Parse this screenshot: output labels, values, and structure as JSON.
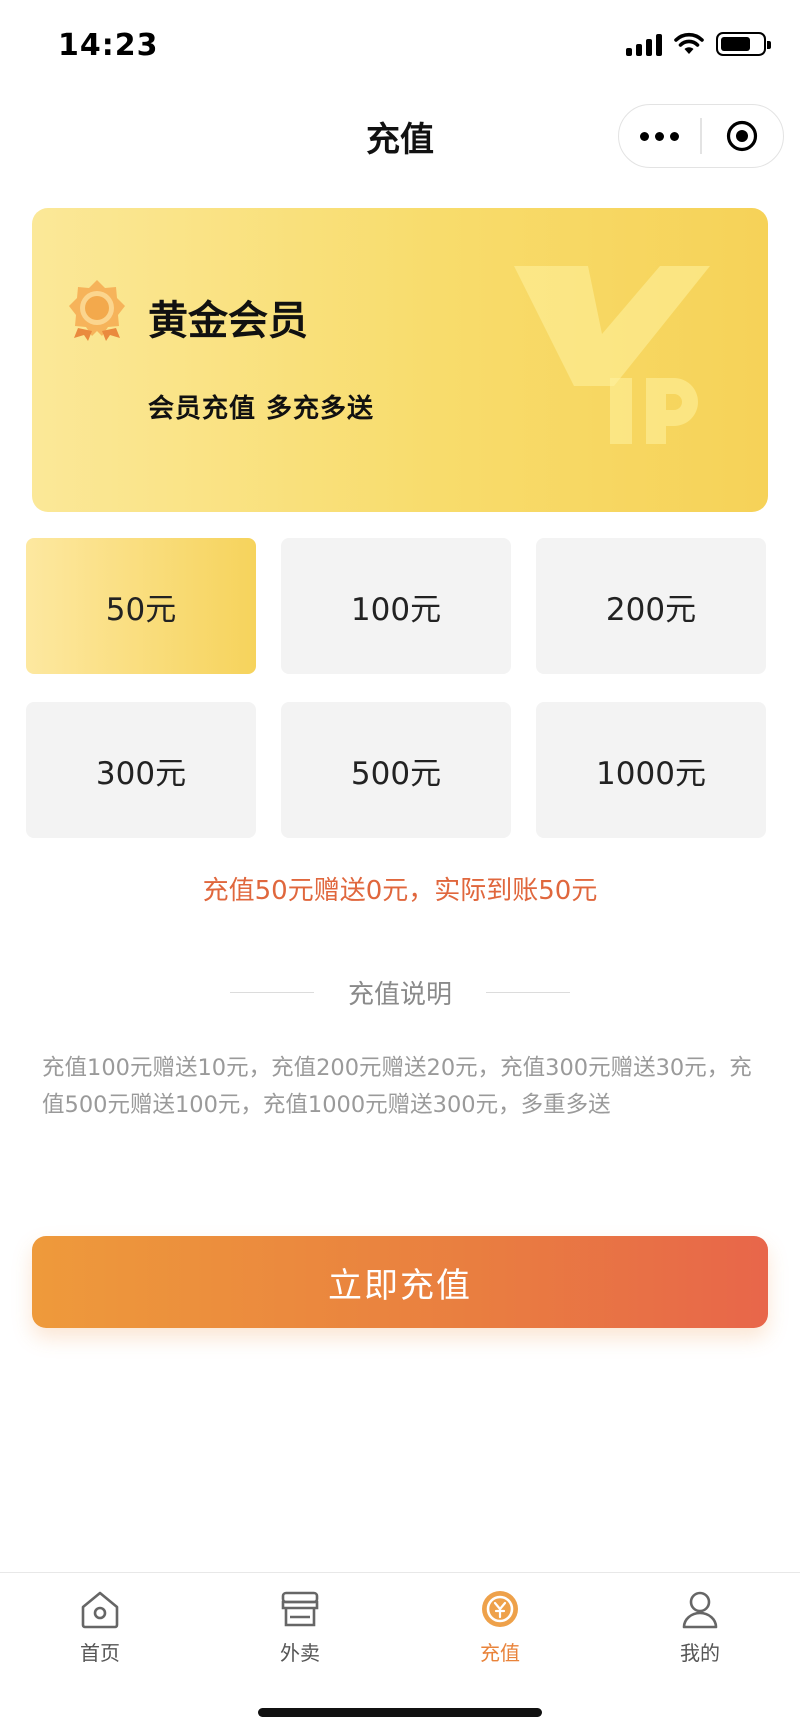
{
  "status_bar": {
    "time": "14:23"
  },
  "nav": {
    "title": "充值"
  },
  "vip_card": {
    "title": "黄金会员",
    "subtitle": "会员充值 多充多送",
    "watermark": "VIP"
  },
  "amounts": [
    {
      "label": "50元",
      "selected": true
    },
    {
      "label": "100元",
      "selected": false
    },
    {
      "label": "200元",
      "selected": false
    },
    {
      "label": "300元",
      "selected": false
    },
    {
      "label": "500元",
      "selected": false
    },
    {
      "label": "1000元",
      "selected": false
    }
  ],
  "summary": "充值50元赠送0元，实际到账50元",
  "description": {
    "title": "充值说明",
    "text": "充值100元赠送10元，充值200元赠送20元，充值300元赠送30元，充值500元赠送100元，充值1000元赠送300元，多重多送"
  },
  "recharge_button": "立即充值",
  "tab_bar": {
    "items": [
      {
        "label": "首页",
        "icon": "home-icon",
        "active": false
      },
      {
        "label": "外卖",
        "icon": "store-icon",
        "active": false
      },
      {
        "label": "充值",
        "icon": "recharge-coin-icon",
        "active": true
      },
      {
        "label": "我的",
        "icon": "user-icon",
        "active": false
      }
    ]
  },
  "colors": {
    "accent": "#e9833a",
    "summary_text": "#e0673d",
    "gold": "#f6d35c",
    "button_start": "#ee9a3b",
    "button_end": "#e8664a"
  }
}
